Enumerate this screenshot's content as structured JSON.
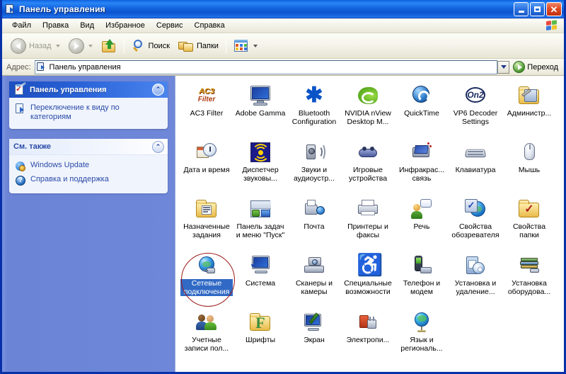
{
  "window": {
    "title": "Панель управления",
    "title_icon": "control-panel-icon",
    "buttons": {
      "minimize": "_",
      "maximize": "□",
      "close": "✕"
    }
  },
  "menubar": {
    "items": [
      {
        "label": "Файл"
      },
      {
        "label": "Правка"
      },
      {
        "label": "Вид"
      },
      {
        "label": "Избранное"
      },
      {
        "label": "Сервис"
      },
      {
        "label": "Справка"
      }
    ],
    "logo": "windows-flag-logo"
  },
  "toolbar": {
    "back_label": "Назад",
    "forward_label": "",
    "up_label": "",
    "search_label": "Поиск",
    "folders_label": "Папки",
    "views_label": ""
  },
  "addressbar": {
    "label": "Адрес:",
    "value": "Панель управления",
    "go_label": "Переход"
  },
  "sidebar": {
    "panels": [
      {
        "title": "Панель управления",
        "style": "blue",
        "icon": "control-panel-clipboard-icon",
        "collapse": "⌃",
        "links": [
          {
            "label": "Переключение к виду по категориям",
            "icon": "switch-view-icon"
          }
        ]
      },
      {
        "title": "См. также",
        "style": "light",
        "icon": "",
        "collapse": "⌃",
        "links": [
          {
            "label": "Windows Update",
            "icon": "windows-update-icon"
          },
          {
            "label": "Справка и поддержка",
            "icon": "help-support-icon"
          }
        ]
      }
    ]
  },
  "main": {
    "items": [
      {
        "label": "AC3 Filter",
        "icon": "ac3-filter-icon",
        "selected": false
      },
      {
        "label": "Adobe Gamma",
        "icon": "adobe-gamma-icon",
        "selected": false
      },
      {
        "label": "Bluetooth Configuration",
        "icon": "bluetooth-icon",
        "selected": false
      },
      {
        "label": "NVIDIA nView Desktop M...",
        "icon": "nvidia-nview-icon",
        "selected": false
      },
      {
        "label": "QuickTime",
        "icon": "quicktime-icon",
        "selected": false
      },
      {
        "label": "VP6 Decoder Settings",
        "icon": "vp6-decoder-icon",
        "selected": false
      },
      {
        "label": "Администр...",
        "icon": "administrative-tools-icon",
        "selected": false
      },
      {
        "label": "Дата и время",
        "icon": "date-time-icon",
        "selected": false
      },
      {
        "label": "Диспетчер звуковы...",
        "icon": "sound-manager-icon",
        "selected": false
      },
      {
        "label": "Звуки и аудиоустр...",
        "icon": "sounds-audio-icon",
        "selected": false
      },
      {
        "label": "Игровые устройства",
        "icon": "gaming-devices-icon",
        "selected": false
      },
      {
        "label": "Инфракрас... связь",
        "icon": "infrared-icon",
        "selected": false
      },
      {
        "label": "Клавиатура",
        "icon": "keyboard-icon",
        "selected": false
      },
      {
        "label": "Мышь",
        "icon": "mouse-icon",
        "selected": false
      },
      {
        "label": "Назначенные задания",
        "icon": "scheduled-tasks-icon",
        "selected": false
      },
      {
        "label": "Панель задач и меню \"Пуск\"",
        "icon": "taskbar-startmenu-icon",
        "selected": false
      },
      {
        "label": "Почта",
        "icon": "mail-icon",
        "selected": false
      },
      {
        "label": "Принтеры и факсы",
        "icon": "printers-faxes-icon",
        "selected": false
      },
      {
        "label": "Речь",
        "icon": "speech-icon",
        "selected": false
      },
      {
        "label": "Свойства обозревателя",
        "icon": "internet-options-icon",
        "selected": false
      },
      {
        "label": "Свойства папки",
        "icon": "folder-options-icon",
        "selected": false
      },
      {
        "label": "Сетевые подключения",
        "icon": "network-connections-icon",
        "selected": true
      },
      {
        "label": "Система",
        "icon": "system-icon",
        "selected": false
      },
      {
        "label": "Сканеры и камеры",
        "icon": "scanners-cameras-icon",
        "selected": false
      },
      {
        "label": "Специальные возможности",
        "icon": "accessibility-icon",
        "selected": false
      },
      {
        "label": "Телефон и модем",
        "icon": "phone-modem-icon",
        "selected": false
      },
      {
        "label": "Установка и удаление...",
        "icon": "add-remove-programs-icon",
        "selected": false
      },
      {
        "label": "Установка оборудова...",
        "icon": "add-hardware-icon",
        "selected": false
      },
      {
        "label": "Учетные записи пол...",
        "icon": "user-accounts-icon",
        "selected": false
      },
      {
        "label": "Шрифты",
        "icon": "fonts-icon",
        "selected": false
      },
      {
        "label": "Экран",
        "icon": "display-icon",
        "selected": false
      },
      {
        "label": "Электропи...",
        "icon": "power-options-icon",
        "selected": false
      },
      {
        "label": "Язык и региональ...",
        "icon": "regional-language-icon",
        "selected": false
      }
    ],
    "annotation": {
      "shape": "ellipse",
      "color": "#a01818",
      "target": "Сетевые подключения"
    }
  },
  "colors": {
    "titlebar_blue": "#0a55d0",
    "sidebar_blue": "#6e87d8",
    "selection_blue": "#316ac5",
    "annotation_red": "#a01818",
    "panel_bg": "#f0f4fd",
    "link_blue": "#2a4ba8"
  }
}
